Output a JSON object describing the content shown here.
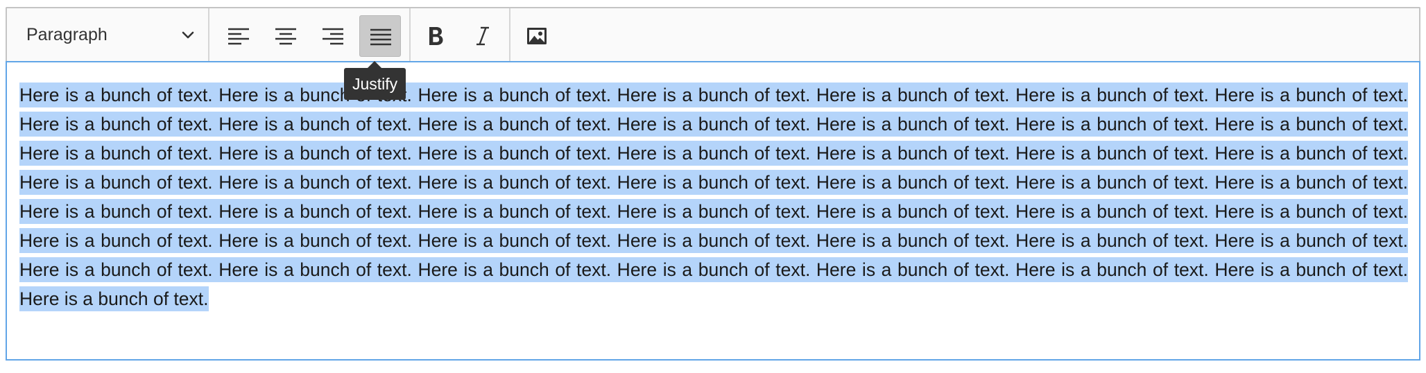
{
  "toolbar": {
    "heading": {
      "label": "Paragraph",
      "icon": "chevron-down-icon"
    },
    "buttons": [
      {
        "name": "align-left",
        "icon": "align-left-icon",
        "active": false
      },
      {
        "name": "align-center",
        "icon": "align-center-icon",
        "active": false
      },
      {
        "name": "align-right",
        "icon": "align-right-icon",
        "active": false
      },
      {
        "name": "align-justify",
        "icon": "align-justify-icon",
        "active": true
      },
      {
        "name": "bold",
        "icon": "bold-icon",
        "active": false
      },
      {
        "name": "italic",
        "icon": "italic-icon",
        "active": false
      },
      {
        "name": "insert-image",
        "icon": "image-icon",
        "active": false
      }
    ],
    "tooltip": "Justify"
  },
  "content": {
    "sentence": "Here is a bunch of text.",
    "sentence_count": 50,
    "selected": true,
    "alignment": "justify"
  },
  "colors": {
    "selection": "#b4d4fa",
    "focus_border": "#61a5e7",
    "toolbar_bg": "#fafafa",
    "active_button": "#cacaca",
    "tooltip_bg": "#333333"
  }
}
